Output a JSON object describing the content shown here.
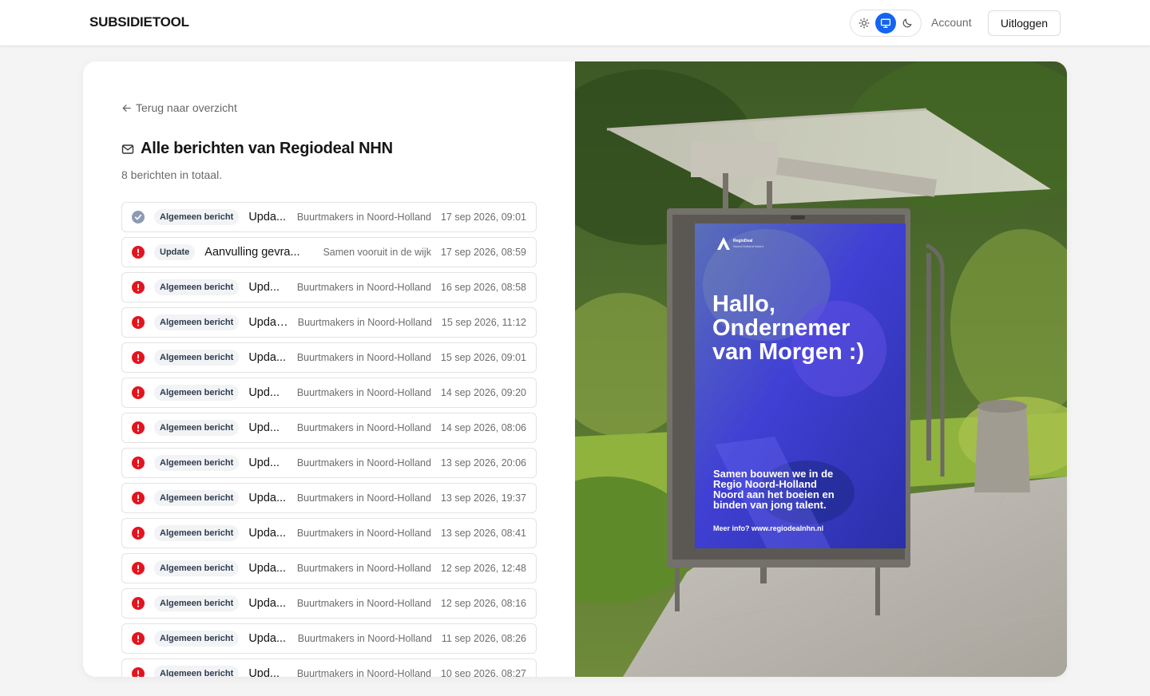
{
  "header": {
    "brand": "SUBSIDIETOOL",
    "account_label": "Account",
    "logout_label": "Uitloggen"
  },
  "theme_switch": {
    "options": [
      "sun-icon",
      "monitor-icon",
      "moon-icon"
    ],
    "active": "monitor-icon"
  },
  "page": {
    "back_label": "Terug naar overzicht",
    "title": "Alle berichten van Regiodeal NHN",
    "count_text": "8 berichten in totaal."
  },
  "messages": [
    {
      "status": "read",
      "type": "Algemeen bericht",
      "subject": "Upda...",
      "sender": "Buurtmakers in Noord-Holland",
      "date": "17 sep 2026, 09:01"
    },
    {
      "status": "unread",
      "type": "Update",
      "subject": "Aanvulling gevra...",
      "sender": "Samen vooruit in de wijk",
      "date": "17 sep 2026, 08:59"
    },
    {
      "status": "unread",
      "type": "Algemeen bericht",
      "subject": "Upd...",
      "sender": "Buurtmakers in Noord-Holland",
      "date": "16 sep 2026, 08:58"
    },
    {
      "status": "unread",
      "type": "Algemeen bericht",
      "subject": "Updat...",
      "sender": "Buurtmakers in Noord-Holland",
      "date": "15 sep 2026, 11:12"
    },
    {
      "status": "unread",
      "type": "Algemeen bericht",
      "subject": "Upda...",
      "sender": "Buurtmakers in Noord-Holland",
      "date": "15 sep 2026, 09:01"
    },
    {
      "status": "unread",
      "type": "Algemeen bericht",
      "subject": "Upd...",
      "sender": "Buurtmakers in Noord-Holland",
      "date": "14 sep 2026, 09:20"
    },
    {
      "status": "unread",
      "type": "Algemeen bericht",
      "subject": "Upd...",
      "sender": "Buurtmakers in Noord-Holland",
      "date": "14 sep 2026, 08:06"
    },
    {
      "status": "unread",
      "type": "Algemeen bericht",
      "subject": "Upd...",
      "sender": "Buurtmakers in Noord-Holland",
      "date": "13 sep 2026, 20:06"
    },
    {
      "status": "unread",
      "type": "Algemeen bericht",
      "subject": "Upda...",
      "sender": "Buurtmakers in Noord-Holland",
      "date": "13 sep 2026, 19:37"
    },
    {
      "status": "unread",
      "type": "Algemeen bericht",
      "subject": "Upda...",
      "sender": "Buurtmakers in Noord-Holland",
      "date": "13 sep 2026, 08:41"
    },
    {
      "status": "unread",
      "type": "Algemeen bericht",
      "subject": "Upda...",
      "sender": "Buurtmakers in Noord-Holland",
      "date": "12 sep 2026, 12:48"
    },
    {
      "status": "unread",
      "type": "Algemeen bericht",
      "subject": "Upda...",
      "sender": "Buurtmakers in Noord-Holland",
      "date": "12 sep 2026, 08:16"
    },
    {
      "status": "unread",
      "type": "Algemeen bericht",
      "subject": "Upda...",
      "sender": "Buurtmakers in Noord-Holland",
      "date": "11 sep 2026, 08:26"
    },
    {
      "status": "unread",
      "type": "Algemeen bericht",
      "subject": "Upd...",
      "sender": "Buurtmakers in Noord-Holland",
      "date": "10 sep 2026, 08:27"
    }
  ],
  "poster": {
    "logo_text": "RegioDeal",
    "logo_sub": "Noord-Holland Noord",
    "headline": [
      "Hallo,",
      "Ondernemer",
      "van Morgen :)"
    ],
    "body": [
      "Samen bouwen we in de",
      "Regio Noord-Holland",
      "Noord aan het boeien en",
      "binden van jong talent."
    ],
    "footer": "Meer info? www.regiodealnhn.nl"
  },
  "colors": {
    "accent": "#1463f3",
    "unread": "#e3141d",
    "read": "#8c9ab3",
    "poster_blue": "#3f3fd8"
  }
}
